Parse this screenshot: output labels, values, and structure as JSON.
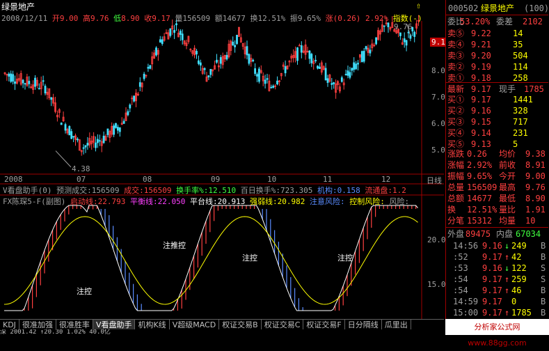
{
  "header": {
    "stock_name": "绿景地产",
    "date": "2008/12/11",
    "open_label": "开",
    "open": "9.00",
    "high_label": "高",
    "high": "9.76",
    "low_label": "低",
    "low": "8.90",
    "close_label": "收",
    "close": "9.17",
    "vol_label": "量",
    "vol": "156509",
    "amt_label": "额",
    "amt": "14677",
    "turn_label": "换",
    "turn": "12.51%",
    "amp_label": "振",
    "amp": "9.65%",
    "chg_label": "涨",
    "chg": "(0.26)",
    "chg_pct": "2.92%",
    "index_label": "指数(-)"
  },
  "price_axis": {
    "labels": [
      "9.17",
      "8.00",
      "7.00",
      "6.00",
      "5.00"
    ],
    "current": "9.17"
  },
  "price_notes": {
    "high": "9.76",
    "low": "4.38"
  },
  "months": [
    "2008",
    "07",
    "08",
    "09",
    "10",
    "11",
    "12"
  ],
  "period": "日线",
  "ind1": {
    "name": "V看盘助手(0)",
    "pred_label": "预测成交:",
    "pred": "156509",
    "vol_label": "成交:",
    "vol": "156509",
    "turn_label": "换手率%:",
    "turn": "12.510",
    "hundred_label": "百日换手%:",
    "hundred": "723.305",
    "inst_label": "机构:",
    "inst": "0.158",
    "flow_label": "流通盘:",
    "flow": "1.2"
  },
  "ind2": {
    "name": "FX陈琛5-F(副图)",
    "start_label": "启动线:",
    "start": "22.793",
    "bal_label": "平衡线:",
    "bal": "22.050",
    "plat_label": "平台线:",
    "plat": "20.913",
    "strong_label": "强弱线:",
    "strong": "20.982",
    "risk_label": "注意风险:",
    "ctrl_label": "控制风险:",
    "risk2_label": "风险:",
    "axis": [
      "20.00",
      "15.00"
    ],
    "notes": [
      "注控",
      "注推控",
      "注控",
      "注控"
    ]
  },
  "tabs": [
    "KDJ",
    "很准加强",
    "很准胜率",
    "V看盘助手",
    "机构K线",
    "V超级MACD",
    "权证交易B",
    "权证交易C",
    "权证交易F",
    "日分隔线",
    "瓜里出"
  ],
  "bottom_text": "深 2001.42 ↑20.30 1.02% 40.0亿",
  "right": {
    "code": "000502",
    "name": "绿景地产",
    "suffix": "(100)",
    "weibi_label": "委比",
    "weibi": "53.20%",
    "weicha_label": "委差",
    "weicha": "2102",
    "asks": [
      {
        "label": "卖⑤",
        "price": "9.22",
        "vol": "14"
      },
      {
        "label": "卖④",
        "price": "9.21",
        "vol": "35"
      },
      {
        "label": "卖③",
        "price": "9.20",
        "vol": "504"
      },
      {
        "label": "卖②",
        "price": "9.19",
        "vol": "114"
      },
      {
        "label": "卖①",
        "price": "9.18",
        "vol": "258"
      }
    ],
    "last_label": "最新",
    "last": "9.17",
    "now_label": "现手",
    "now": "1785",
    "bids": [
      {
        "label": "买①",
        "price": "9.17",
        "vol": "1441"
      },
      {
        "label": "买②",
        "price": "9.16",
        "vol": "328"
      },
      {
        "label": "买③",
        "price": "9.15",
        "vol": "717"
      },
      {
        "label": "买④",
        "price": "9.14",
        "vol": "231"
      },
      {
        "label": "买⑤",
        "price": "9.13",
        "vol": "5"
      }
    ],
    "stats": [
      {
        "l1": "涨跌",
        "v1": "0.26",
        "l2": "均价",
        "v2": "9.38"
      },
      {
        "l1": "涨幅",
        "v1": "2.92%",
        "l2": "前收",
        "v2": "8.91"
      },
      {
        "l1": "振幅",
        "v1": "9.65%",
        "l2": "今开",
        "v2": "9.00"
      },
      {
        "l1": "总量",
        "v1": "156509",
        "l2": "最高",
        "v2": "9.76"
      },
      {
        "l1": "总额",
        "v1": "14677",
        "l2": "最低",
        "v2": "8.90"
      },
      {
        "l1": "换",
        "v1": "12.51%",
        "l2": "量比",
        "v2": "1.91"
      },
      {
        "l1": "分笔",
        "v1": "15312",
        "l2": "均量",
        "v2": "10"
      }
    ],
    "outer_label": "外盘",
    "outer": "89475",
    "inner_label": "内盘",
    "inner": "67034",
    "ticks": [
      {
        "t": "14:56",
        "p": "9.16",
        "a": "↓",
        "v": "249",
        "s": "B"
      },
      {
        "t": ":52",
        "p": "9.17",
        "a": "↑",
        "v": "42",
        "s": "B"
      },
      {
        "t": ":53",
        "p": "9.16",
        "a": "↓",
        "v": "122",
        "s": "S"
      },
      {
        "t": ":54",
        "p": "9.17",
        "a": "↑",
        "v": "259",
        "s": "S"
      },
      {
        "t": ":54",
        "p": "9.17",
        "a": "↑",
        "v": "46",
        "s": "B"
      },
      {
        "t": "14:59",
        "p": "9.17",
        "a": "",
        "v": "0",
        "s": "B"
      },
      {
        "t": "15:00",
        "p": "9.17",
        "a": "↑",
        "v": "1785",
        "s": "B"
      }
    ]
  },
  "watermark": "分析家公式网www.88gg.com",
  "colors": {
    "up": "#ff4040",
    "down": "#40e0ff",
    "ma": "#ffff00",
    "frame": "#a00000"
  }
}
